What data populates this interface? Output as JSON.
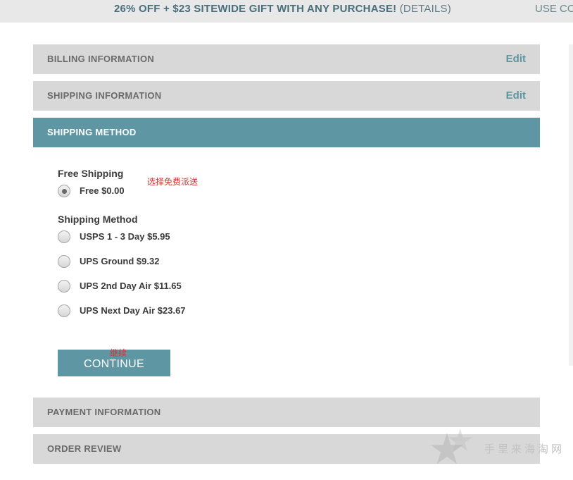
{
  "promo": {
    "headline": "26% OFF + $23 SITEWIDE GIFT WITH ANY PURCHASE!",
    "details_link": "(DETAILS)",
    "right_text": "USE CO"
  },
  "sections": {
    "billing": {
      "title": "BILLING INFORMATION",
      "edit_label": "Edit"
    },
    "shipping_info": {
      "title": "SHIPPING INFORMATION",
      "edit_label": "Edit"
    },
    "shipping_method": {
      "title": "SHIPPING METHOD"
    },
    "payment": {
      "title": "PAYMENT INFORMATION"
    },
    "review": {
      "title": "ORDER REVIEW"
    }
  },
  "shipping_form": {
    "free_group_title": "Free Shipping",
    "free_option": {
      "label": "Free $0.00",
      "selected": true
    },
    "method_group_title": "Shipping Method",
    "options": [
      {
        "label": "USPS 1 - 3 Day $5.95",
        "selected": false
      },
      {
        "label": "UPS Ground $9.32",
        "selected": false
      },
      {
        "label": "UPS 2nd Day Air $11.65",
        "selected": false
      },
      {
        "label": "UPS Next Day Air $23.67",
        "selected": false
      }
    ],
    "continue_label": "CONTINUE"
  },
  "annotations": {
    "free_note": "选择免费派送",
    "continue_note": "继续"
  },
  "watermark": {
    "text": "手里来海淘网",
    "icon": "star-icon"
  },
  "colors": {
    "accent": "#5e97a3",
    "section_bg": "#d8d8d8",
    "promo_text": "#4a6f7c",
    "annotation": "#d0322e"
  }
}
